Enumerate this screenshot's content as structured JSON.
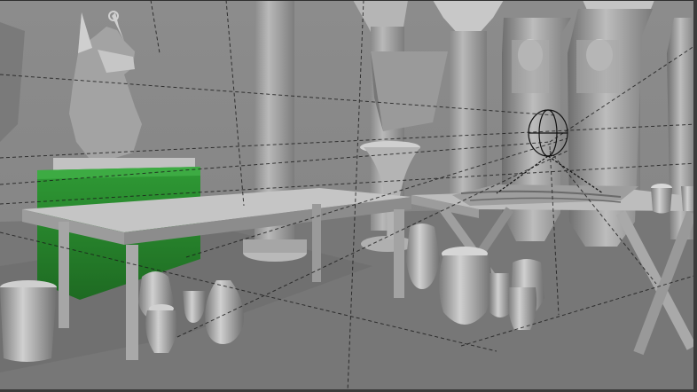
{
  "viewport": {
    "mode": "3d-perspective-viewport",
    "shading": "solid-gray",
    "selection_highlight_color": "#2a8a2a",
    "camera_guides": "dashed-lines",
    "ground_color": "#777777",
    "wall_color": "#8a8a8a"
  },
  "objects": [
    {
      "name": "anubis-bust"
    },
    {
      "name": "green-pedestal",
      "selected": true
    },
    {
      "name": "left-table"
    },
    {
      "name": "right-table"
    },
    {
      "name": "sarcophagus-1"
    },
    {
      "name": "sarcophagus-2"
    },
    {
      "name": "sarcophagus-3"
    },
    {
      "name": "column-1"
    },
    {
      "name": "column-2"
    },
    {
      "name": "column-3"
    },
    {
      "name": "column-4"
    },
    {
      "name": "papyrus-scroll"
    },
    {
      "name": "bucket"
    },
    {
      "name": "vases"
    },
    {
      "name": "light-gizmo"
    }
  ]
}
